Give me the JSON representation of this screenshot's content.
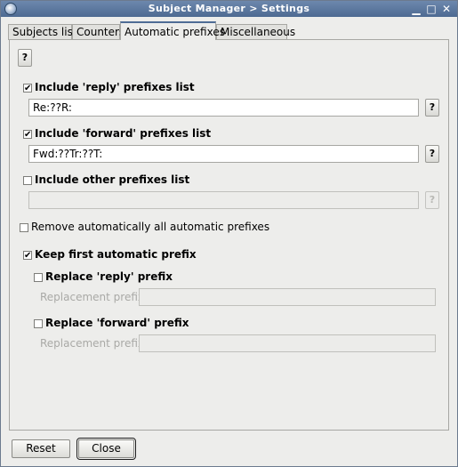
{
  "window": {
    "title": "Subject Manager > Settings",
    "controls": {
      "minimize": "▁",
      "maximize": "□",
      "close": "✕"
    }
  },
  "tabs": [
    {
      "label": "Subjects list",
      "active": false
    },
    {
      "label": "Counters",
      "active": false
    },
    {
      "label": "Automatic prefixes",
      "active": true
    },
    {
      "label": "Miscellaneous",
      "active": false
    }
  ],
  "help_label": "?",
  "reply": {
    "label": "Include 'reply' prefixes list",
    "checked": true,
    "value": "Re:??R:"
  },
  "forward": {
    "label": "Include 'forward' prefixes list",
    "checked": true,
    "value": "Fwd:??Tr:??T:"
  },
  "other": {
    "label": "Include other prefixes list",
    "checked": false,
    "value": ""
  },
  "remove_all": {
    "label": "Remove automatically all automatic prefixes",
    "checked": false
  },
  "keep_first": {
    "label": "Keep first automatic prefix",
    "checked": true
  },
  "replace_reply": {
    "label": "Replace 'reply' prefix",
    "checked": false,
    "field_label": "Replacement prefix",
    "value": ""
  },
  "replace_forward": {
    "label": "Replace 'forward' prefix",
    "checked": false,
    "field_label": "Replacement prefix",
    "value": ""
  },
  "check_mark": "✔",
  "buttons": {
    "reset": "Reset",
    "close": "Close"
  }
}
